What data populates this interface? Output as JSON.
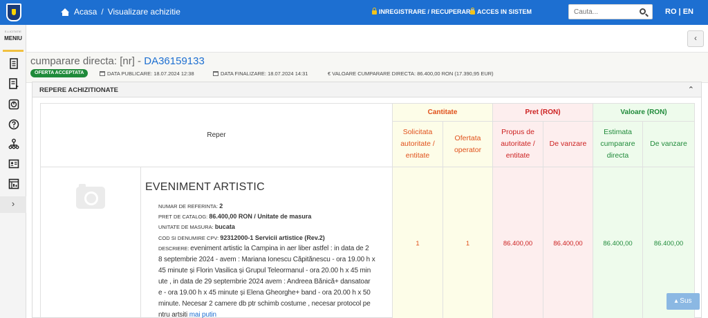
{
  "header": {
    "home_label": "Acasa",
    "breadcrumb_sep": "/",
    "breadcrumb_current": "Visualizare achizitie",
    "register_link": "INREGISTRARE / RECUPERARE",
    "login_link": "ACCES IN SISTEM",
    "search_placeholder": "Cauta...",
    "lang": "RO | EN"
  },
  "sidebar": {
    "menu_sub": "E-LICITATIE",
    "menu_label": "MENIU",
    "expand": "›",
    "icons": [
      "document-icon",
      "list-icon",
      "chart-icon",
      "help-icon",
      "tree-icon",
      "id-card-icon",
      "report-icon"
    ]
  },
  "collapse_button": "‹",
  "page": {
    "title_prefix": "cumparare directa: [nr] - ",
    "title_code": "DA36159133",
    "status_badge": "OFERTA ACCEPTATA",
    "data_publicare": "DATA PUBLICARE: 18.07.2024 12:38",
    "data_finalizare": "DATA FINALIZARE: 18.07.2024 14:31",
    "valoare": "€ VALOARE CUMPARARE DIRECTA: 86.400,00  RON (17.390,95  EUR)"
  },
  "panel": {
    "title": "REPERE ACHIZITIONATE",
    "caret": "⌃"
  },
  "table": {
    "reper_header": "Reper",
    "groups": {
      "cantitate": "Cantitate",
      "pret": "Pret (RON)",
      "valoare": "Valoare (RON)"
    },
    "sub": {
      "solicitata": "Solicitata autoritate / entitate",
      "ofertata": "Ofertata operator",
      "propus": "Propus de autoritate / entitate",
      "de_vanzare_pret": "De vanzare",
      "estimata": "Estimata cumparare directa",
      "de_vanzare_val": "De vanzare"
    },
    "row": {
      "title": "EVENIMENT ARTISTIC",
      "nr_ref_label": "NUMAR DE REFERINTA: ",
      "nr_ref_value": "2",
      "pret_label": "PRET DE CATALOG: ",
      "pret_value": "86.400,00  RON / Unitate de masura",
      "um_label": "UNITATE DE MASURA: ",
      "um_value": "bucata",
      "cpv_label": "COD SI DENUMIRE CPV: ",
      "cpv_value": "92312000-1 Servicii artistice (Rev.2)",
      "desc_label": "DESCRIERE: ",
      "desc_lines": [
        "eveniment artistic la Campina in aer liber astfel : in data de 2",
        "8 septembrie 2024 - avem : Mariana Ionescu Căpitănescu - ora 19.00 h x",
        "45 minute și Florin Vasilica și Grupul Teleormanul - ora 20.00 h x 45 min",
        "ute , in data de 29 septembrie 2024 avem : Andreea Bănică+ dansatoar",
        "e - ora 19.00 h x 45 minute și Elena Gheorghe+ band - ora 20.00 h x 50",
        "minute. Necesar 2 camere db ptr schimb costume , necesar protocol pe",
        "ntru artsiti "
      ],
      "mai_putin": "mai putin",
      "solicitata": "1",
      "ofertata": "1",
      "propus": "86.400,00",
      "de_vanzare_pret": "86.400,00",
      "estimata": "86.400,00",
      "de_vanzare_val": "86.400,00"
    }
  },
  "scroll_top": "Sus"
}
